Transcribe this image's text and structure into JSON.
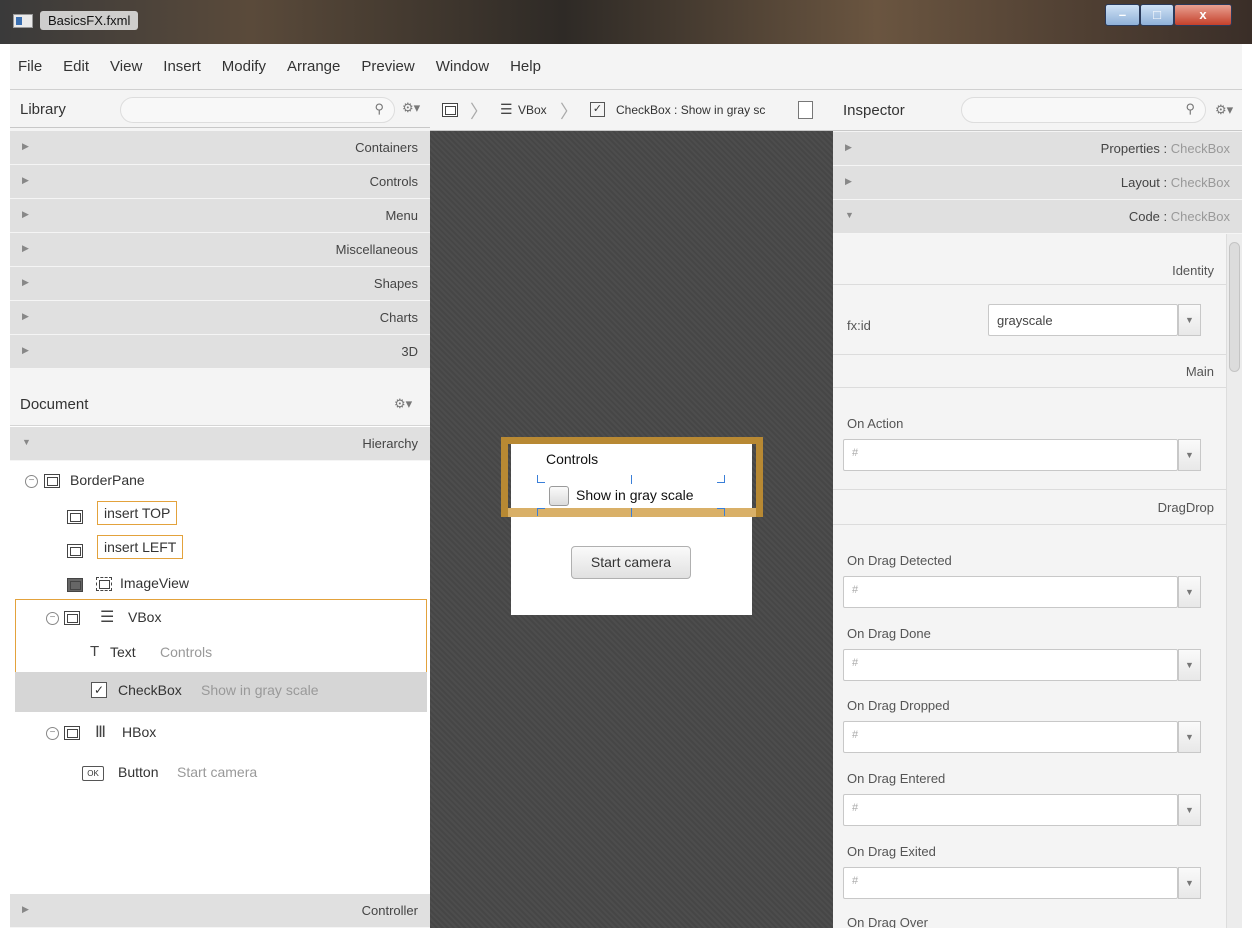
{
  "window": {
    "title": "BasicsFX.fxml",
    "controls": {
      "minimize": "–",
      "maximize": "□",
      "close": "x"
    }
  },
  "menu": [
    "File",
    "Edit",
    "View",
    "Insert",
    "Modify",
    "Arrange",
    "Preview",
    "Window",
    "Help"
  ],
  "library": {
    "title": "Library",
    "sections": [
      "Containers",
      "Controls",
      "Menu",
      "Miscellaneous",
      "Shapes",
      "Charts",
      "3D"
    ]
  },
  "document": {
    "title": "Document",
    "hierarchy_label": "Hierarchy",
    "controller_label": "Controller",
    "tree": {
      "borderpane": "BorderPane",
      "insert_top": "insert TOP",
      "insert_left": "insert LEFT",
      "imageview": "ImageView",
      "vbox": "VBox",
      "text_type": "Text",
      "text_value": "Controls",
      "checkbox_type": "CheckBox",
      "checkbox_value": "Show in gray scale",
      "hbox": "HBox",
      "button_type": "Button",
      "button_value": "Start camera"
    }
  },
  "breadcrumb": {
    "vbox": "VBox",
    "checkbox": "CheckBox : Show in gray sc"
  },
  "preview": {
    "heading": "Controls",
    "checkbox_label": "Show in gray scale",
    "button_label": "Start camera"
  },
  "inspector": {
    "title": "Inspector",
    "sections": [
      {
        "name": "Properties",
        "target": "CheckBox"
      },
      {
        "name": "Layout",
        "target": "CheckBox"
      },
      {
        "name": "Code",
        "target": "CheckBox"
      }
    ],
    "identity": "Identity",
    "fxid_label": "fx:id",
    "fxid_value": "grayscale",
    "main": "Main",
    "on_action": "On Action",
    "dragdrop": "DragDrop",
    "events": [
      "On Drag Detected",
      "On Drag Done",
      "On Drag Dropped",
      "On Drag Entered",
      "On Drag Exited",
      "On Drag Over"
    ],
    "hash": "#"
  },
  "colors": {
    "selection": "#e3a23c",
    "canvas": "#4a4a4a",
    "accordion": "#e0e0e0"
  }
}
